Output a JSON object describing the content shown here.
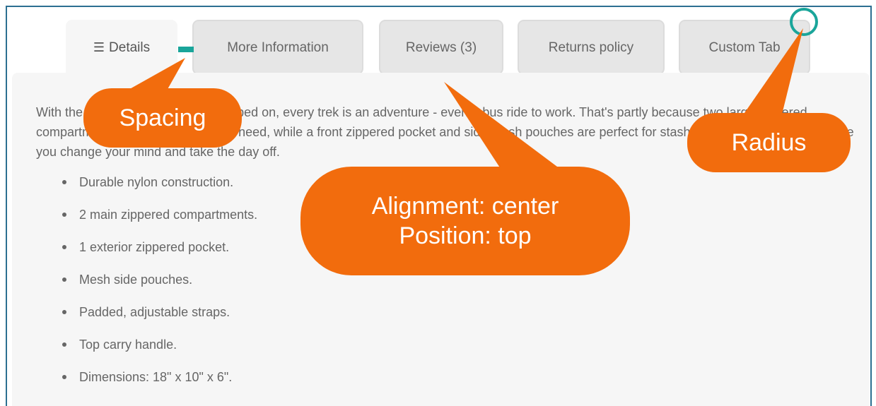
{
  "tabs": [
    {
      "label": "Details",
      "icon": "list-icon",
      "active": true
    },
    {
      "label": "More Information"
    },
    {
      "label": "Reviews (3)"
    },
    {
      "label": "Returns policy"
    },
    {
      "label": "Custom Tab"
    }
  ],
  "panel": {
    "description": "With the Strive Shoulder Pack strapped on, every trek is an adventure - even a bus ride to work. That's partly because two large zippered compartments store everything you need, while a front zippered pocket and side mesh pouches are perfect for stashing those little extras, in case you change your mind and take the day off.",
    "features": [
      "Durable nylon construction.",
      "2 main zippered compartments.",
      "1 exterior zippered pocket.",
      "Mesh side pouches.",
      "Padded, adjustable straps.",
      "Top carry handle.",
      "Dimensions: 18\" x 10\" x 6\"."
    ]
  },
  "annotations": {
    "spacing": "Spacing",
    "radius": "Radius",
    "alignment_line1": "Alignment: center",
    "alignment_line2": "Position: top"
  },
  "colors": {
    "callout": "#f26c0d",
    "marker": "#1aa59a",
    "frame": "#2c6f91",
    "panel": "#f6f6f6"
  }
}
